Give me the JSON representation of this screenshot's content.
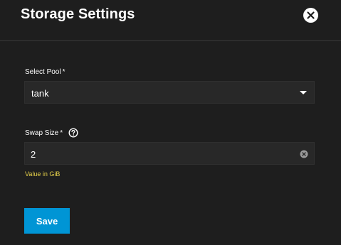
{
  "dialog": {
    "title": "Storage Settings",
    "close_icon": "close-icon"
  },
  "pool": {
    "label": "Select Pool",
    "required_mark": "*",
    "value": "tank",
    "icon": "chevron-down-icon"
  },
  "swap": {
    "label": "Swap Size",
    "required_mark": "*",
    "help_icon": "help-icon",
    "value": "2",
    "clear_icon": "clear-icon",
    "hint": "Value in GiB"
  },
  "actions": {
    "save_label": "Save"
  },
  "colors": {
    "background": "#1e1e1e",
    "field_background": "#282828",
    "primary": "#0095d5",
    "hint": "#e6d14a",
    "text": "#ffffff"
  }
}
